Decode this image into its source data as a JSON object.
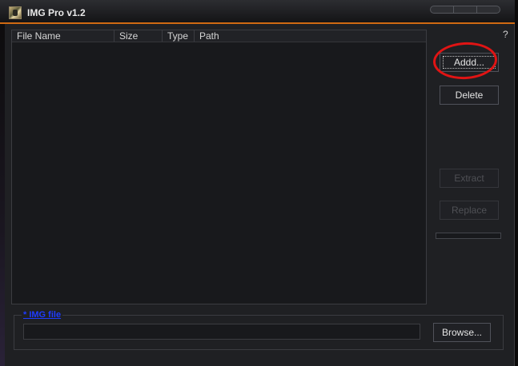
{
  "window": {
    "title": "IMG Pro v1.2"
  },
  "help_label": "?",
  "file_list": {
    "columns": [
      "File Name",
      "Size",
      "Type",
      "Path"
    ],
    "rows": []
  },
  "buttons": {
    "add": "Addd...",
    "delete": "Delete",
    "extract": "Extract",
    "replace": "Replace",
    "browse": "Browse..."
  },
  "img_file": {
    "label": "* IMG file",
    "value": ""
  },
  "progress": {
    "value": 0
  },
  "annotation": {
    "color": "#e01414"
  }
}
